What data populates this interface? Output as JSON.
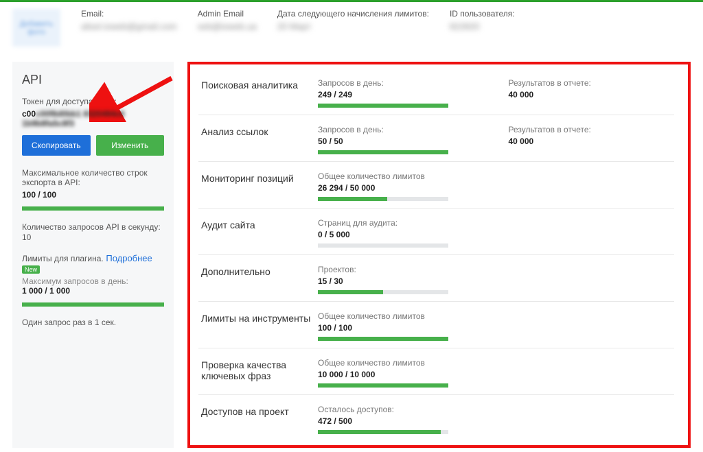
{
  "header": {
    "avatar_text": "Добавить фото",
    "email_label": "Email:",
    "email_value": "alisel.ioweb@gmail.com",
    "admin_label": "Admin Email",
    "admin_value": "seb@ioweb.ua",
    "next_date_label": "Дата следующего начисления лимитов:",
    "next_date_value": "20 Март",
    "user_id_label": "ID пользователя:",
    "user_id_value": "822820"
  },
  "api": {
    "title": "API",
    "token_label": "Токен для доступа к API:",
    "token_value": "c00f8d0bb1 8320494c6 1b9b8fa5c8f3",
    "copy_btn": "Скопировать",
    "change_btn": "Изменить",
    "max_rows_label": "Максимальное количество строк экспорта в API:",
    "max_rows_value": "100 / 100",
    "rps_label": "Количество запросов API в секунду:",
    "rps_value": "10",
    "plugin_label": "Лимиты для плагина.",
    "plugin_link": "Подробнее",
    "new_badge": "New",
    "plugin_max_label": "Максимум запросов в день:",
    "plugin_max_value": "1 000 / 1 000",
    "rate_note": "Один запрос раз в 1 сек."
  },
  "limits": [
    {
      "name": "Поисковая аналитика",
      "metrics": [
        {
          "label": "Запросов в день:",
          "value": "249 / 249",
          "pct": 100
        },
        {
          "label": "Результатов в отчете:",
          "value": "40 000"
        }
      ]
    },
    {
      "name": "Анализ ссылок",
      "metrics": [
        {
          "label": "Запросов в день:",
          "value": "50 / 50",
          "pct": 100
        },
        {
          "label": "Результатов в отчете:",
          "value": "40 000"
        }
      ]
    },
    {
      "name": "Мониторинг позиций",
      "metrics": [
        {
          "label": "Общее количество лимитов",
          "value": "26 294 / 50 000",
          "pct": 53
        }
      ]
    },
    {
      "name": "Аудит сайта",
      "metrics": [
        {
          "label": "Страниц для аудита:",
          "value": "0 / 5 000",
          "pct": 0,
          "track": true
        }
      ]
    },
    {
      "name": "Дополнительно",
      "metrics": [
        {
          "label": "Проектов:",
          "value": "15 / 30",
          "pct": 50
        }
      ]
    },
    {
      "name": "Лимиты на инструменты",
      "metrics": [
        {
          "label": "Общее количество лимитов",
          "value": "100 / 100",
          "pct": 100
        }
      ]
    },
    {
      "name": "Проверка качества ключевых фраз",
      "metrics": [
        {
          "label": "Общее количество лимитов",
          "value": "10 000 / 10 000",
          "pct": 100
        }
      ]
    },
    {
      "name": "Доступов на проект",
      "metrics": [
        {
          "label": "Осталось доступов:",
          "value": "472 / 500",
          "pct": 94
        }
      ]
    }
  ]
}
